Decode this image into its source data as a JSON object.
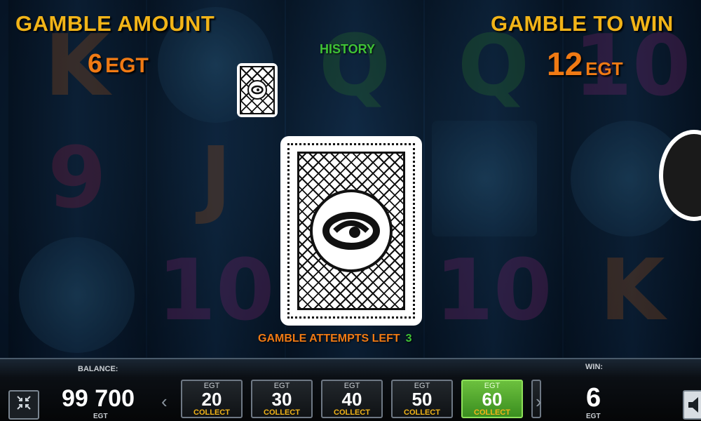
{
  "header": {
    "gamble_amount_label": "GAMBLE AMOUNT",
    "gamble_amount_value": "6",
    "gamble_amount_currency": "EGT",
    "gamble_to_win_label": "GAMBLE TO WIN",
    "gamble_to_win_value": "12",
    "gamble_to_win_currency": "EGT"
  },
  "history": {
    "label": "HISTORY",
    "cards": [
      "card-back"
    ]
  },
  "card": {
    "state": "face-down"
  },
  "attempts": {
    "label": "GAMBLE ATTEMPTS LEFT",
    "count": "3"
  },
  "reel_symbols": [
    "K",
    "9",
    "10",
    "J",
    "10",
    "Q",
    "10",
    "K"
  ],
  "bottom_bar": {
    "balance_label": "BALANCE:",
    "balance_value": "99 700",
    "balance_currency": "EGT",
    "win_label": "WIN:",
    "win_value": "6",
    "win_currency": "EGT",
    "prev_arrow": "‹",
    "next_arrow": "›",
    "denominations": [
      {
        "currency": "EGT",
        "value": "20",
        "action": "COLLECT",
        "active": false
      },
      {
        "currency": "EGT",
        "value": "30",
        "action": "COLLECT",
        "active": false
      },
      {
        "currency": "EGT",
        "value": "40",
        "action": "COLLECT",
        "active": false
      },
      {
        "currency": "EGT",
        "value": "50",
        "action": "COLLECT",
        "active": false
      },
      {
        "currency": "EGT",
        "value": "60",
        "action": "COLLECT",
        "active": true
      }
    ]
  },
  "colors": {
    "header_gold": "#f2b418",
    "amount_orange": "#f07a14",
    "history_green": "#3fc236",
    "active_denom_green": "#5cb033"
  },
  "icons": {
    "fullscreen": "collapse-icon",
    "sound": "speaker-icon"
  }
}
